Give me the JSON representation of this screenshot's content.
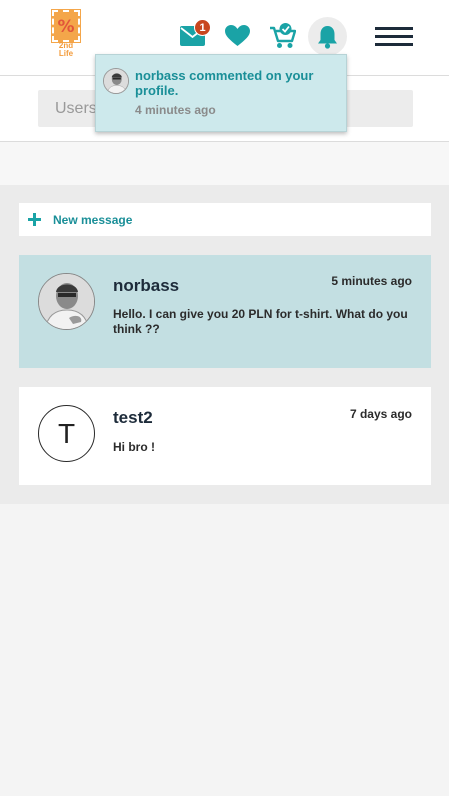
{
  "header": {
    "logo_text": "2nd Life",
    "logo_symbol": "%",
    "icons": [
      "mail-icon",
      "heart-icon",
      "cart-icon",
      "bell-icon",
      "menu-icon"
    ],
    "mail_badge": "1"
  },
  "search": {
    "placeholder": "Users",
    "value": ""
  },
  "new_message": {
    "label": "New message"
  },
  "conversations": [
    {
      "name": "norbass",
      "time": "5 minutes ago",
      "message": "Hello. I can give you 20 PLN for t-shirt. What do you think ??",
      "avatar": "photo",
      "highlighted": true
    },
    {
      "name": "test2",
      "time": "7 days ago",
      "message": "Hi bro !",
      "avatar_letter": "T",
      "highlighted": false
    }
  ],
  "notification": {
    "text": "norbass commented on your profile.",
    "time": "4 minutes ago"
  },
  "colors": {
    "accent": "#1a8f98",
    "badge": "#c8461e",
    "highlight_bg": "#c3dfe2",
    "notification_bg": "#cde9ec",
    "logo_orange": "#f4a64a"
  }
}
